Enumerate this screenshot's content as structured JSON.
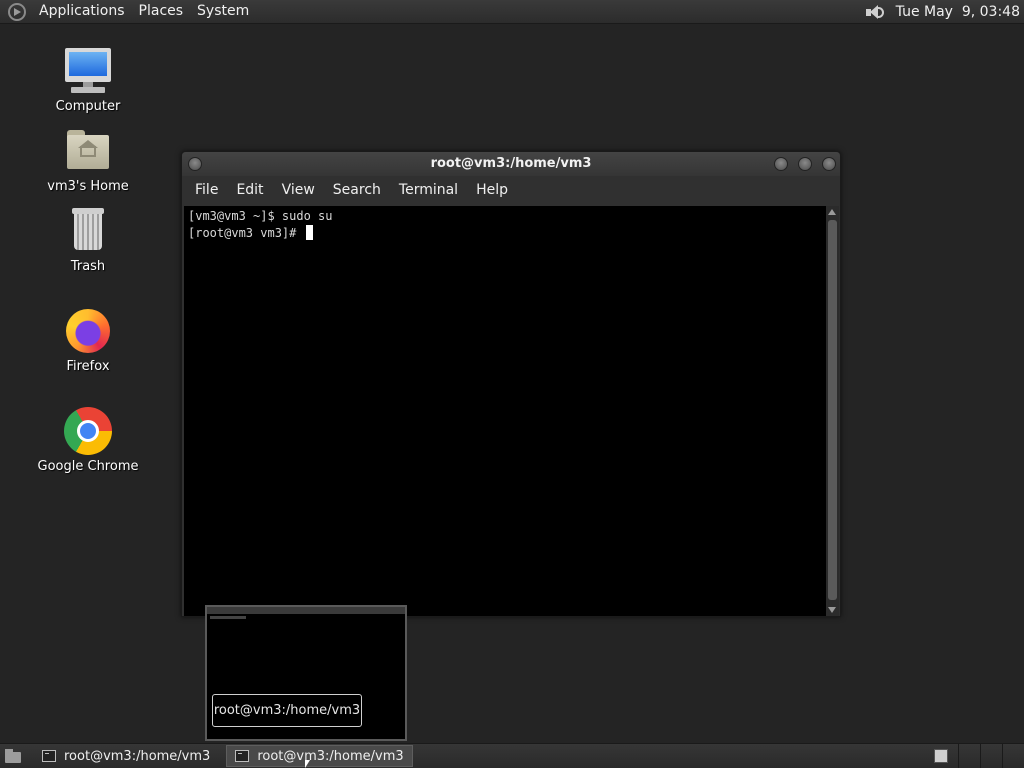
{
  "top_panel": {
    "menus": [
      "Applications",
      "Places",
      "System"
    ],
    "clock": "Tue May  9, 03:48"
  },
  "desktop_icons": [
    {
      "label": "Computer",
      "icon": "computer-icon"
    },
    {
      "label": "vm3's Home",
      "icon": "home-folder-icon"
    },
    {
      "label": "Trash",
      "icon": "trash-icon"
    },
    {
      "label": "Firefox",
      "icon": "firefox-icon"
    },
    {
      "label": "Google Chrome",
      "icon": "chrome-icon"
    }
  ],
  "terminal": {
    "title": "root@vm3:/home/vm3",
    "menu": [
      "File",
      "Edit",
      "View",
      "Search",
      "Terminal",
      "Help"
    ],
    "lines": [
      "[vm3@vm3 ~]$ sudo su",
      "[root@vm3 vm3]# "
    ]
  },
  "preview": {
    "label": "root@vm3:/home/vm3"
  },
  "taskbar": {
    "items": [
      "root@vm3:/home/vm3",
      "root@vm3:/home/vm3"
    ],
    "active_index": 1
  }
}
